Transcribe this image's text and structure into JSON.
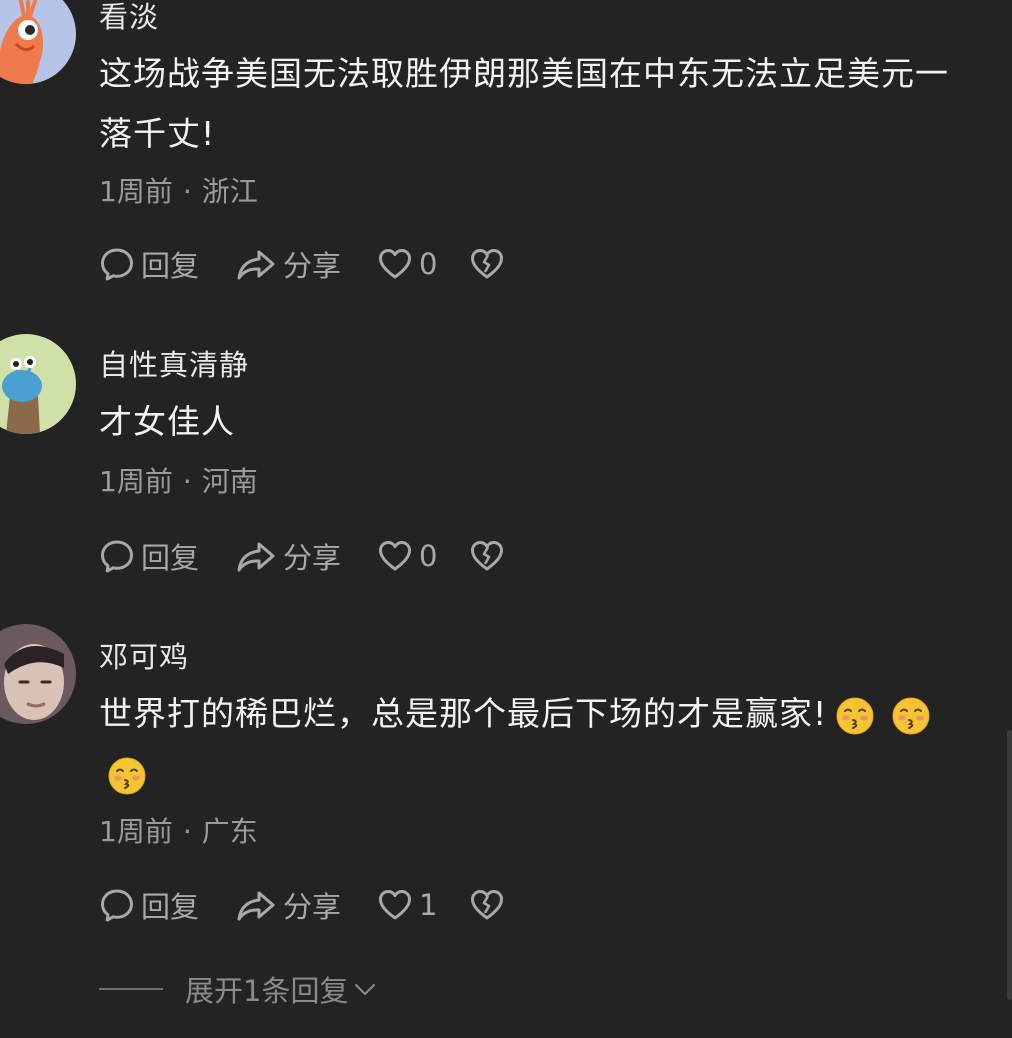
{
  "colors": {
    "background": "#232323",
    "username": "#e8e8e8",
    "body_text": "#f2f2f2",
    "meta_text": "#9a9a9a",
    "action_text": "#a8a8a8"
  },
  "comments": [
    {
      "username": "看淡",
      "text": "这场战争美国无法取胜伊朗那美国在中东无法立足美元一落千丈!",
      "time": "1周前",
      "separator": "·",
      "location": "浙江",
      "reply_label": "回复",
      "share_label": "分享",
      "like_count": "0",
      "avatar_icon": "cartoon-shrimp-avatar"
    },
    {
      "username": "自性真清静",
      "text": "才女佳人",
      "time": "1周前",
      "separator": "·",
      "location": "河南",
      "reply_label": "回复",
      "share_label": "分享",
      "like_count": "0",
      "avatar_icon": "cartoon-snail-avatar"
    },
    {
      "username": "邓可鸡",
      "text": "世界打的稀巴烂，总是那个最后下场的才是赢家!",
      "emojis": [
        "kiss-emoji",
        "kiss-emoji",
        "kiss-emoji"
      ],
      "time": "1周前",
      "separator": "·",
      "location": "广东",
      "reply_label": "回复",
      "share_label": "分享",
      "like_count": "1",
      "avatar_icon": "photo-avatar",
      "expand_label": "展开1条回复"
    }
  ],
  "icons": {
    "reply": "reply-bubble-icon",
    "share": "share-arrow-icon",
    "like": "heart-icon",
    "dislike": "broken-heart-icon",
    "expand": "chevron-down-icon"
  }
}
